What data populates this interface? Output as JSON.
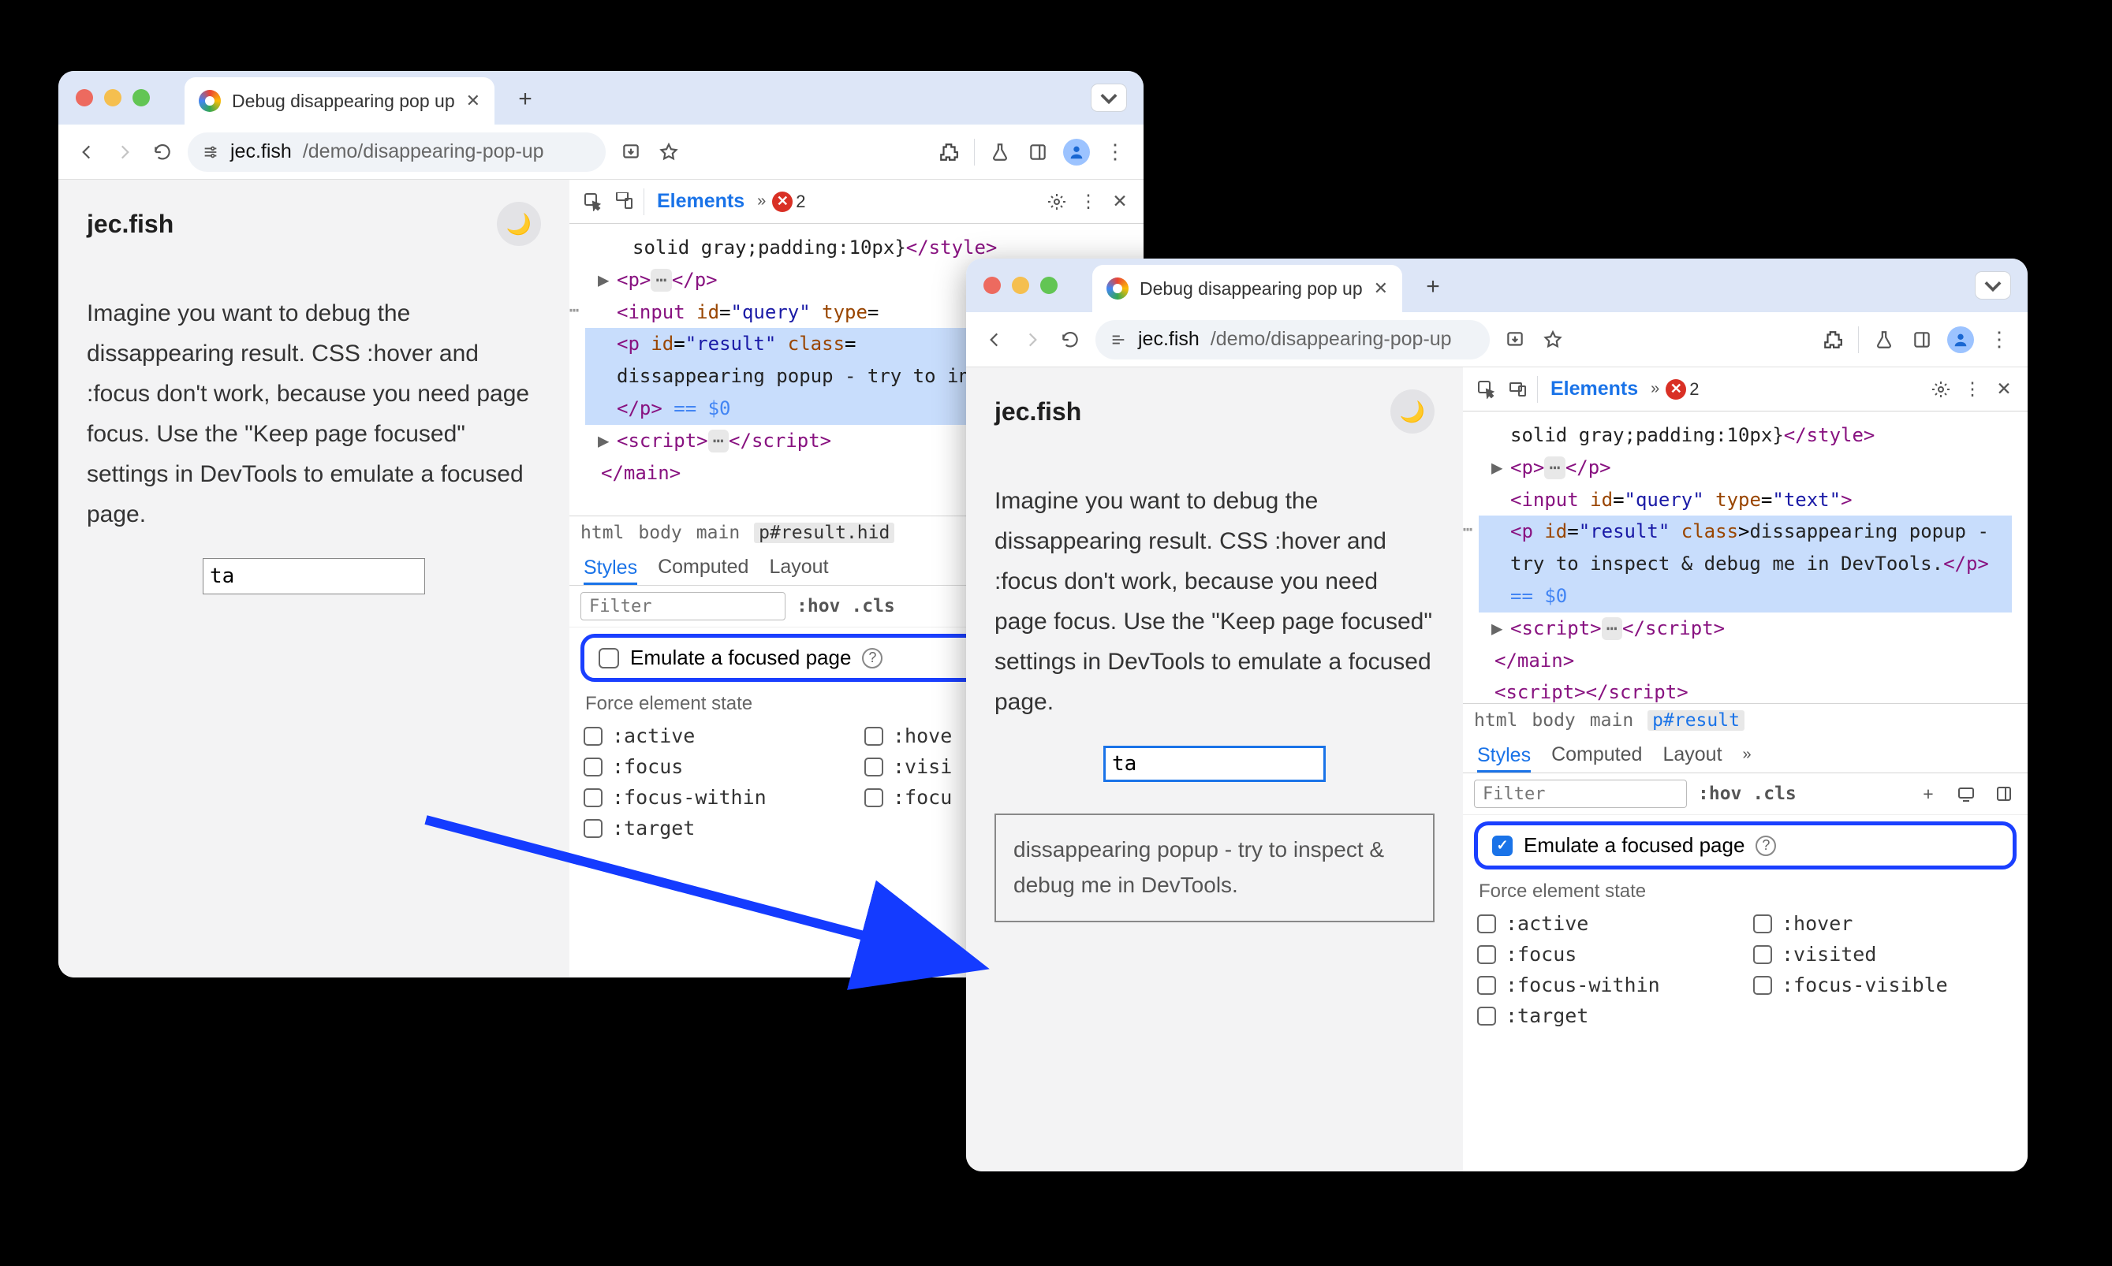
{
  "tab": {
    "title": "Debug disappearing pop up"
  },
  "url": {
    "site": "jec.fish",
    "path": "/demo/disappearing-pop-up"
  },
  "page": {
    "site_name": "jec.fish",
    "text": "Imagine you want to debug the dissappearing result. CSS :hover and :focus don't work, because you need page focus. Use the \"Keep page focused\" settings in DevTools to emulate a focused page.",
    "input_value": "ta",
    "popup_text": "dissappearing popup - try to inspect & debug me in DevTools."
  },
  "devtools": {
    "tabs": {
      "elements": "Elements"
    },
    "error_count": "2",
    "dom": {
      "styleText": "solid gray;padding:10px}",
      "p1_open": "<p>",
      "p1_close": "</p>",
      "input_tag": "<input",
      "input_id_attr": "id",
      "input_id_val": "\"query\"",
      "input_type_attr": "type",
      "input_type_val": "\"text\"",
      "input_end": ">",
      "presult_open": "<p",
      "presult_idattr": "id",
      "presult_idval": "\"result\"",
      "presult_classattr": "class",
      "w1_result_text": "dissappearing popup - try to inspect & debug me in",
      "w2_result_text": "dissappearing popup - try to inspect & debug me in DevTools.",
      "p_close": "</p>",
      "eqdollar": "== $0",
      "script_open": "<script>",
      "script_close": "</script>",
      "main_close": "</main>"
    },
    "crumbs": {
      "html": "html",
      "body": "body",
      "main": "main",
      "result1": "p#result.hid",
      "result2": "p#result"
    },
    "styles": {
      "tab_styles": "Styles",
      "tab_computed": "Computed",
      "tab_layout": "Layout",
      "filter_placeholder": "Filter",
      "hov": ":hov",
      "cls": ".cls",
      "emulate_label": "Emulate a focused page",
      "force_heading": "Force element state",
      "states": {
        "active": ":active",
        "hover": ":hover",
        "focus": ":focus",
        "visited": ":visited",
        "focuswithin": ":focus-within",
        "focusvisible": ":focus-visible",
        "target": ":target",
        "hover_cut": ":hove",
        "visited_cut": ":visi",
        "focusvisible_cut": ":focu"
      }
    }
  }
}
